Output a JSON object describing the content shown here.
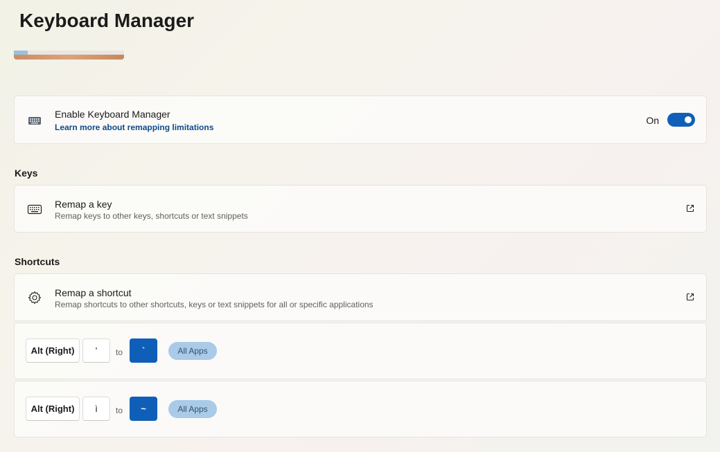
{
  "page": {
    "title": "Keyboard Manager"
  },
  "enable_card": {
    "title": "Enable Keyboard Manager",
    "link": "Learn more about remapping limitations",
    "toggle_label": "On",
    "toggle_on": true,
    "icon": "keyboard-icon"
  },
  "sections": {
    "keys": "Keys",
    "shortcuts": "Shortcuts"
  },
  "remap_key": {
    "title": "Remap a key",
    "subtitle": "Remap keys to other keys, shortcuts or text snippets",
    "icon": "keyboard-icon",
    "action_icon": "open-external-icon"
  },
  "remap_shortcut": {
    "title": "Remap a shortcut",
    "subtitle": "Remap shortcuts to other shortcuts, keys or text snippets for all or specific applications",
    "icon": "gear-icon",
    "action_icon": "open-external-icon"
  },
  "mappings": [
    {
      "modifier": "Alt (Right)",
      "key": "'",
      "to": "to",
      "target": "`",
      "scope": "All Apps"
    },
    {
      "modifier": "Alt (Right)",
      "key": "ì",
      "to": "to",
      "target": "~",
      "scope": "All Apps"
    }
  ],
  "colors": {
    "accent": "#0f5fb8",
    "link": "#0f4a8a",
    "pill_bg": "#a9cbe8"
  }
}
